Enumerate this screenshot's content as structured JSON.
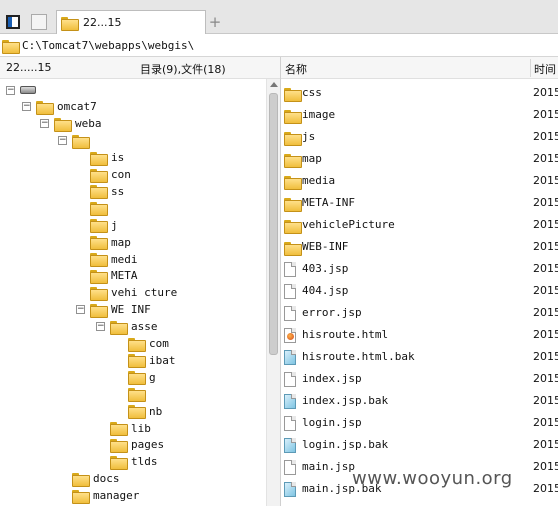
{
  "tabbar": {
    "tab_title": "22...15",
    "new_tab": "+"
  },
  "path": {
    "current": "C:\\Tomcat7\\webapps\\webgis\\"
  },
  "left": {
    "root_label": "22.....15",
    "summary": "目录(9),文件(18)",
    "tree": [
      {
        "label": "",
        "depth": 0,
        "expander": "⊟",
        "icon": "drive"
      },
      {
        "label": "omcat7",
        "depth": 1,
        "expander": "⊟",
        "icon": "folder"
      },
      {
        "label": "weba",
        "depth": 2,
        "expander": "⊟",
        "icon": "folder"
      },
      {
        "label": "",
        "depth": 3,
        "expander": "⊟",
        "icon": "folder"
      },
      {
        "label": "is",
        "depth": 4,
        "expander": "",
        "icon": "folder"
      },
      {
        "label": "con",
        "depth": 4,
        "expander": "",
        "icon": "folder"
      },
      {
        "label": "ss",
        "depth": 4,
        "expander": "",
        "icon": "folder"
      },
      {
        "label": "",
        "depth": 4,
        "expander": "",
        "icon": "folder"
      },
      {
        "label": "j",
        "depth": 4,
        "expander": "",
        "icon": "folder"
      },
      {
        "label": "map",
        "depth": 4,
        "expander": "",
        "icon": "folder"
      },
      {
        "label": "medi",
        "depth": 4,
        "expander": "",
        "icon": "folder"
      },
      {
        "label": "META",
        "depth": 4,
        "expander": "",
        "icon": "folder"
      },
      {
        "label": "vehi     cture",
        "depth": 4,
        "expander": "",
        "icon": "folder"
      },
      {
        "label": "WE  INF",
        "depth": 4,
        "expander": "⊟",
        "icon": "folder"
      },
      {
        "label": "asse",
        "depth": 5,
        "expander": "⊟",
        "icon": "folder"
      },
      {
        "label": "com",
        "depth": 6,
        "expander": "",
        "icon": "folder"
      },
      {
        "label": "ibat",
        "depth": 6,
        "expander": "",
        "icon": "folder"
      },
      {
        "label": "g",
        "depth": 6,
        "expander": "",
        "icon": "folder"
      },
      {
        "label": "",
        "depth": 6,
        "expander": "",
        "icon": "folder"
      },
      {
        "label": "nb",
        "depth": 6,
        "expander": "",
        "icon": "folder"
      },
      {
        "label": "lib",
        "depth": 5,
        "expander": "",
        "icon": "folder"
      },
      {
        "label": "pages",
        "depth": 5,
        "expander": "",
        "icon": "folder"
      },
      {
        "label": "tlds",
        "depth": 5,
        "expander": "",
        "icon": "folder"
      },
      {
        "label": "docs",
        "depth": 3,
        "expander": "",
        "icon": "folder"
      },
      {
        "label": "manager",
        "depth": 3,
        "expander": "",
        "icon": "folder"
      }
    ]
  },
  "right": {
    "col_name": "名称",
    "col_time": "时间",
    "files": [
      {
        "name": "css",
        "time": "2015",
        "type": "folder"
      },
      {
        "name": "image",
        "time": "2015",
        "type": "folder"
      },
      {
        "name": "js",
        "time": "2015",
        "type": "folder"
      },
      {
        "name": "map",
        "time": "2015",
        "type": "folder"
      },
      {
        "name": "media",
        "time": "2015",
        "type": "folder"
      },
      {
        "name": "META-INF",
        "time": "2015",
        "type": "folder"
      },
      {
        "name": "vehiclePicture",
        "time": "2015",
        "type": "folder"
      },
      {
        "name": "WEB-INF",
        "time": "2015",
        "type": "folder"
      },
      {
        "name": "403.jsp",
        "time": "2015",
        "type": "file"
      },
      {
        "name": "404.jsp",
        "time": "2015",
        "type": "file"
      },
      {
        "name": "error.jsp",
        "time": "2015",
        "type": "file"
      },
      {
        "name": "hisroute.html",
        "time": "2015",
        "type": "html"
      },
      {
        "name": "hisroute.html.bak",
        "time": "2015",
        "type": "bak"
      },
      {
        "name": "index.jsp",
        "time": "2015",
        "type": "file"
      },
      {
        "name": "index.jsp.bak",
        "time": "2015",
        "type": "bak"
      },
      {
        "name": "login.jsp",
        "time": "2015",
        "type": "file"
      },
      {
        "name": "login.jsp.bak",
        "time": "2015",
        "type": "bak"
      },
      {
        "name": "main.jsp",
        "time": "2015",
        "type": "file"
      },
      {
        "name": "main.jsp.bak",
        "time": "2015",
        "type": "bak"
      }
    ]
  },
  "watermark": "www.wooyun.org",
  "colors": {
    "folder": "#f0be3c",
    "accent": "#1a5fb4"
  }
}
